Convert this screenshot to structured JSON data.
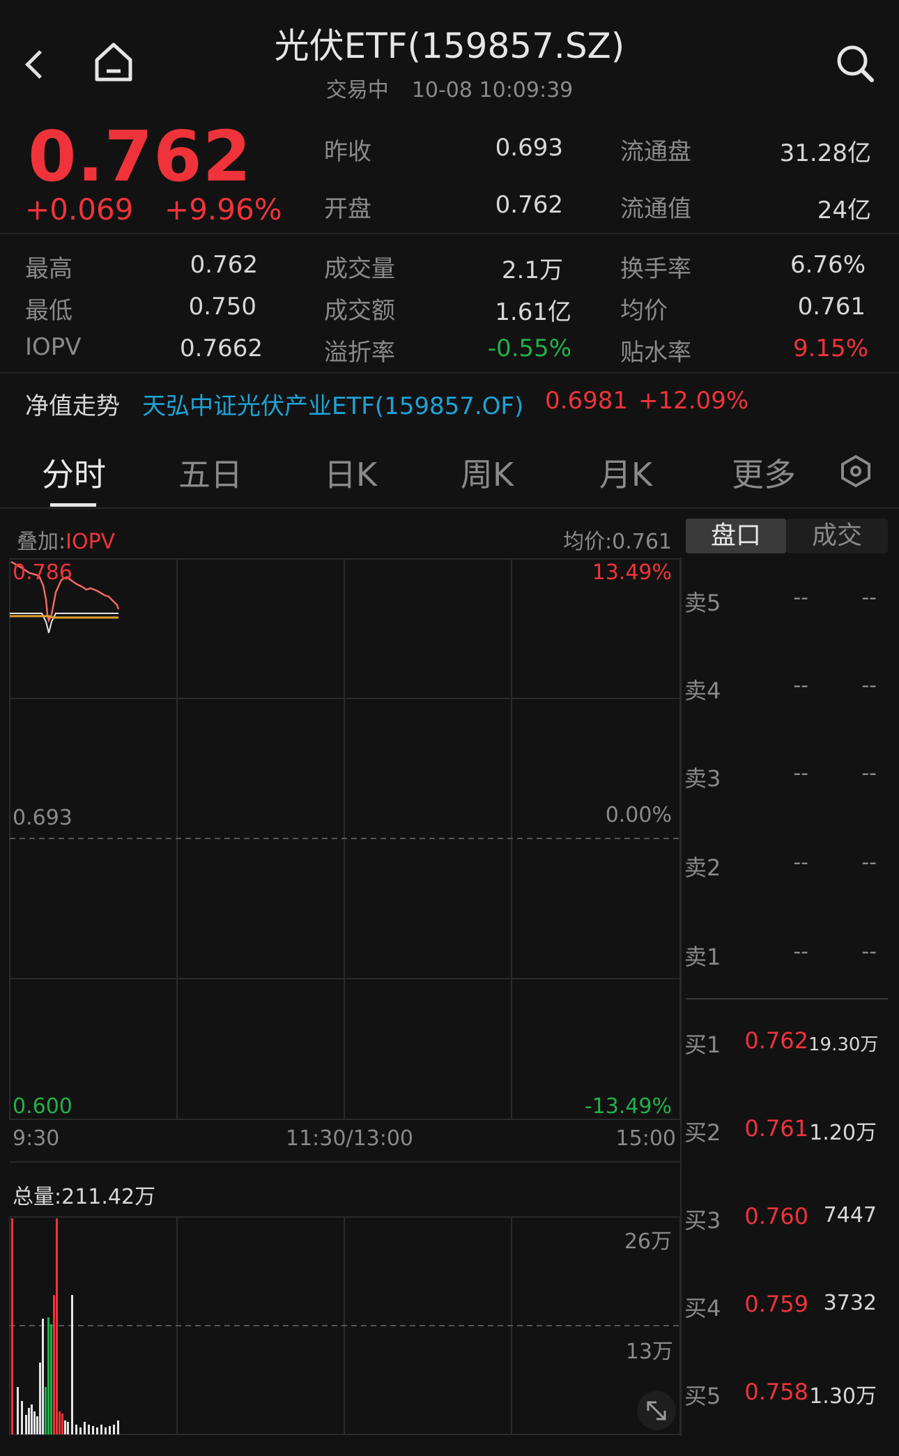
{
  "header": {
    "title": "光伏ETF(159857.SZ)",
    "status": "交易中",
    "datetime": "10-08 10:09:39"
  },
  "quote": {
    "price": "0.762",
    "change": "+0.069",
    "change_pct": "+9.96%",
    "prev_close_label": "昨收",
    "prev_close": "0.693",
    "float_shares_label": "流通盘",
    "float_shares": "31.28亿",
    "open_label": "开盘",
    "open": "0.762",
    "float_value_label": "流通值",
    "float_value": "24亿",
    "high_label": "最高",
    "high": "0.762",
    "volume_label": "成交量",
    "volume": "2.1万",
    "turnover_label": "换手率",
    "turnover": "6.76%",
    "low_label": "最低",
    "low": "0.750",
    "amount_label": "成交额",
    "amount": "1.61亿",
    "avg_label": "均价",
    "avg": "0.761",
    "iopv_label": "IOPV",
    "iopv": "0.7662",
    "premium_label": "溢折率",
    "premium": "-0.55%",
    "discount_label": "贴水率",
    "discount": "9.15%"
  },
  "nav": {
    "label": "净值走势",
    "fund": "天弘中证光伏产业ETF(159857.OF)",
    "value": "0.6981",
    "pct": "+12.09%"
  },
  "tabs": [
    "分时",
    "五日",
    "日K",
    "周K",
    "月K",
    "更多"
  ],
  "chart": {
    "overlay_label": "叠加:",
    "overlay_value": "IOPV",
    "avg_price_text": "均价:0.761",
    "y_top": "0.786",
    "pct_top": "13.49%",
    "y_mid": "0.693",
    "pct_mid": "0.00%",
    "y_bottom": "0.600",
    "pct_bottom": "-13.49%",
    "x_start": "9:30",
    "x_mid": "11:30/13:00",
    "x_end": "15:00",
    "total_volume": "总量:211.42万",
    "vol_top": "26万",
    "vol_mid": "13万"
  },
  "orderbook": {
    "tab_active": "盘口",
    "tab_other": "成交",
    "sells": [
      {
        "label": "卖5",
        "price": "--",
        "vol": "--"
      },
      {
        "label": "卖4",
        "price": "--",
        "vol": "--"
      },
      {
        "label": "卖3",
        "price": "--",
        "vol": "--"
      },
      {
        "label": "卖2",
        "price": "--",
        "vol": "--"
      },
      {
        "label": "卖1",
        "price": "--",
        "vol": "--"
      }
    ],
    "buys": [
      {
        "label": "买1",
        "price": "0.762",
        "vol": "19.30万"
      },
      {
        "label": "买2",
        "price": "0.761",
        "vol": "1.20万"
      },
      {
        "label": "买3",
        "price": "0.760",
        "vol": "7447"
      },
      {
        "label": "买4",
        "price": "0.759",
        "vol": "3732"
      },
      {
        "label": "买5",
        "price": "0.758",
        "vol": "1.30万"
      }
    ]
  },
  "colors": {
    "up": "#f0333a",
    "down": "#22b04a",
    "link": "#1ea3d7",
    "avg_line": "#e0a030"
  }
}
